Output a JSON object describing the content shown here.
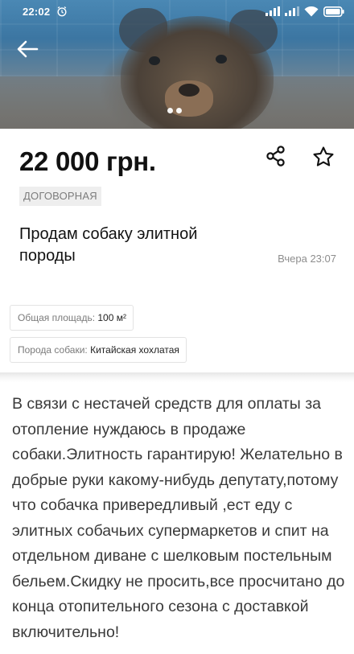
{
  "status_bar": {
    "time": "22:02",
    "icons": [
      "alarm-icon",
      "signal-icon",
      "signal-icon",
      "wifi-icon",
      "battery-icon"
    ]
  },
  "gallery": {
    "dots_count": 2,
    "active_dot": 1
  },
  "listing": {
    "price": "22 000 грн.",
    "negotiable_badge": "ДОГОВОРНАЯ",
    "title": "Продам собаку элитной породы",
    "date": "Вчера 23:07",
    "params": [
      {
        "key": "Общая площадь:",
        "value": "100 м²"
      },
      {
        "key": "Порода собаки:",
        "value": "Китайская хохлатая"
      }
    ],
    "description": "В связи с нестачей средств для оплаты за отопление нуждаюсь в продаже собаки.Элитность гарантирую! Желательно в добрые руки какому-нибудь депутату,потому что собачка привередливый ,ест еду с элитных собачьих супермаркетов и спит на отдельном диване с шелковым постельным бельем.Скидку не просить,все просчитано до конца отопительного сезона с доставкой включительно!"
  },
  "colors": {
    "price_text": "#111111",
    "badge_bg": "#eeeeee",
    "badge_text": "#7c7c7c",
    "muted_text": "#8d8d8d",
    "description_text": "#3a3a3a"
  }
}
